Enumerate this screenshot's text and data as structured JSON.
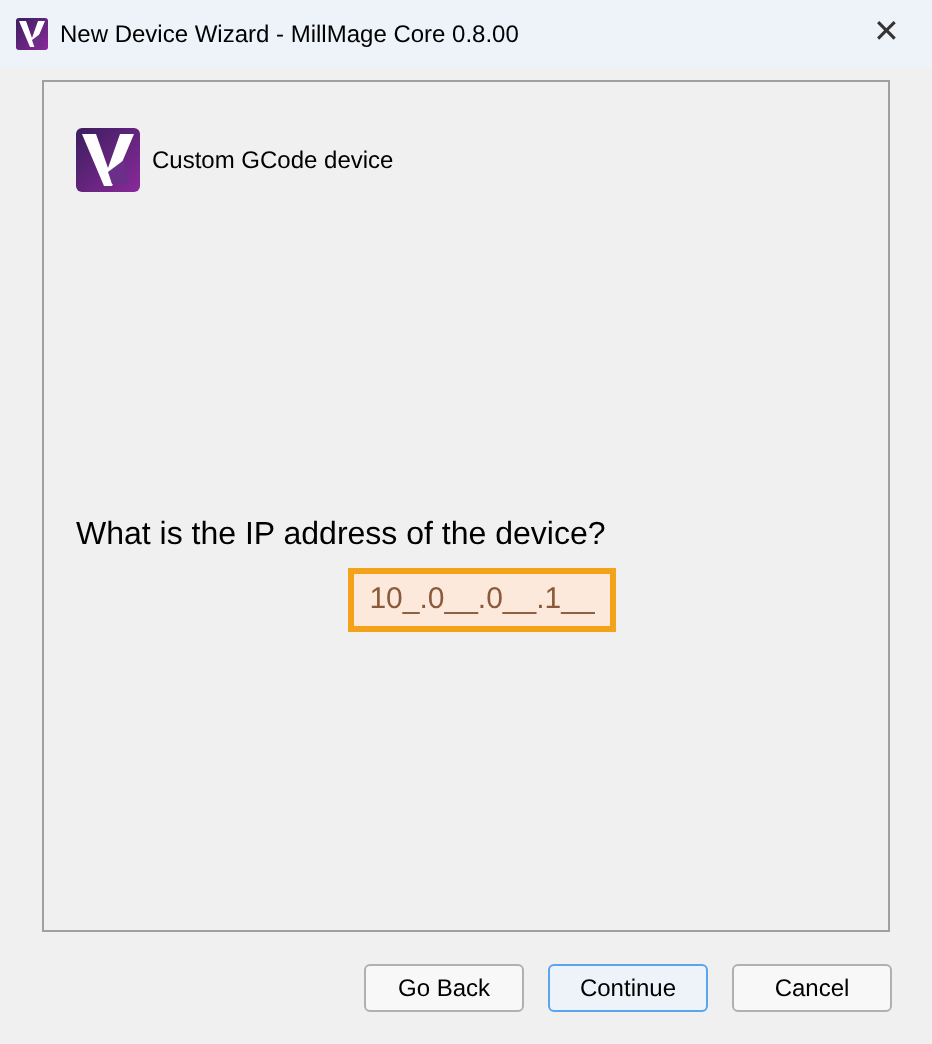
{
  "window": {
    "title": "New Device Wizard - MillMage Core 0.8.00",
    "close": "✕"
  },
  "device": {
    "name": "Custom GCode device"
  },
  "question": "What is the IP address of the device?",
  "ip_field": {
    "value": "10_.0__.0__.1__",
    "focused": true
  },
  "buttons": [
    {
      "label": "Go Back",
      "default": false
    },
    {
      "label": "Continue",
      "default": true
    },
    {
      "label": "Cancel",
      "default": false
    }
  ]
}
